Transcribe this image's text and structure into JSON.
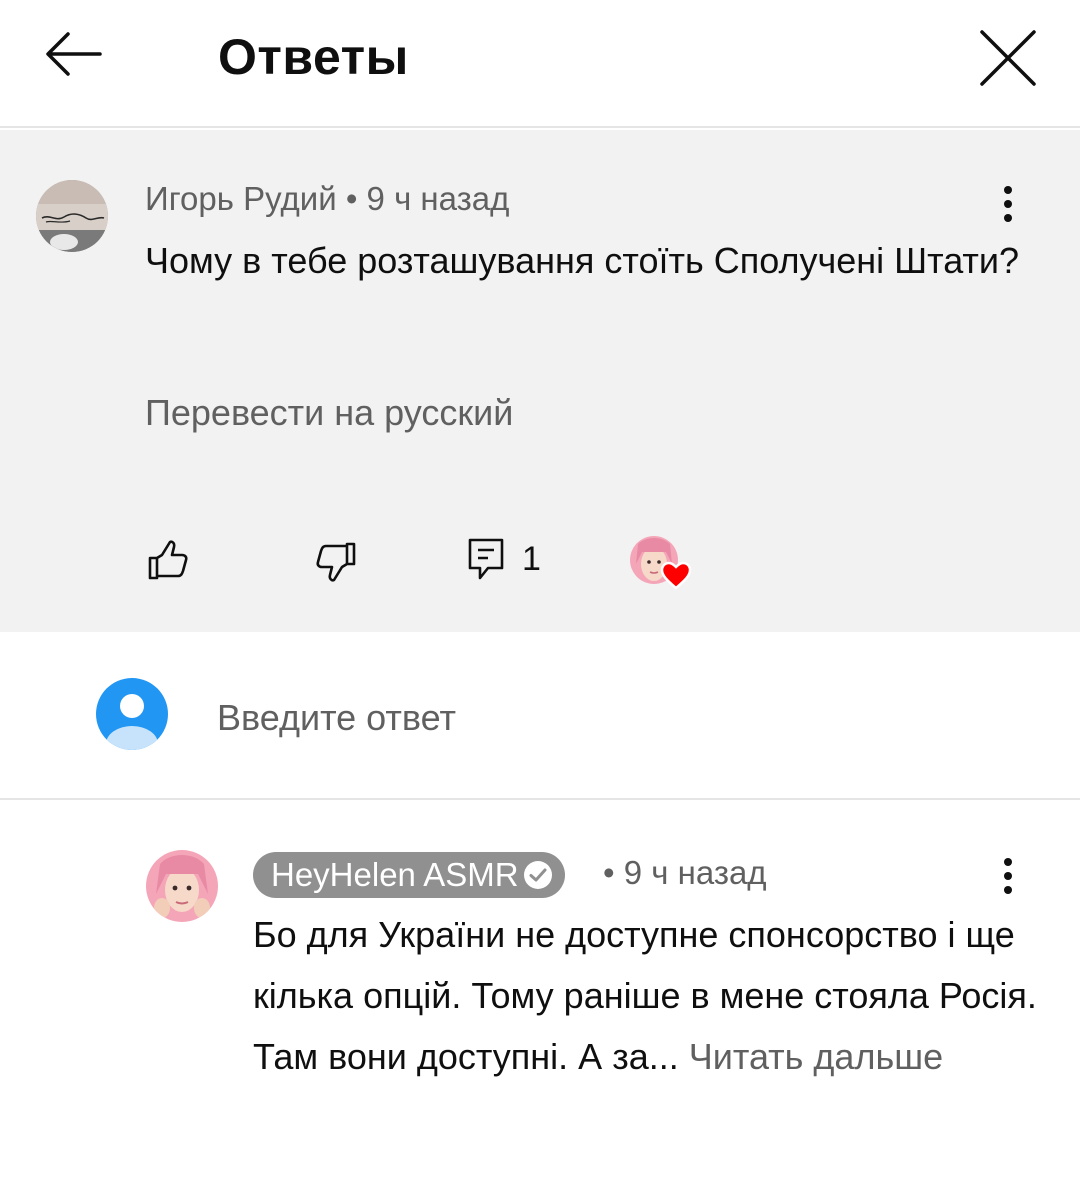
{
  "header": {
    "title": "Ответы",
    "back_icon": "arrow-left-icon",
    "close_icon": "close-icon"
  },
  "parent_comment": {
    "author": "Игорь Рудий",
    "separator": "•",
    "time": "9 ч назад",
    "text": "Чому в тебе розташування стоїть Сполучені Штати?",
    "translate_label": "Перевести на русский",
    "reply_count": "1",
    "icons": [
      "like-icon",
      "dislike-icon",
      "reply-icon",
      "more-vertical-icon",
      "creator-heart-icon"
    ]
  },
  "reply_input": {
    "placeholder": "Введите ответ"
  },
  "reply_comment": {
    "author": "HeyHelen ASMR",
    "separator": "•",
    "time": "9 ч назад",
    "text": "Бо для України не доступне спонсорство і ще кілька опцій. Тому раніше в мене стояла Росія. Там вони доступні. А за...",
    "read_more_label": "Читать дальше",
    "icons": [
      "verified-icon",
      "more-vertical-icon"
    ]
  },
  "colors": {
    "parent_bg": "#f2f2f2",
    "secondary_text": "#606060",
    "author_pill_bg": "#909090",
    "user_avatar_blue": "#2196f3",
    "heart_red": "#ff0000"
  }
}
